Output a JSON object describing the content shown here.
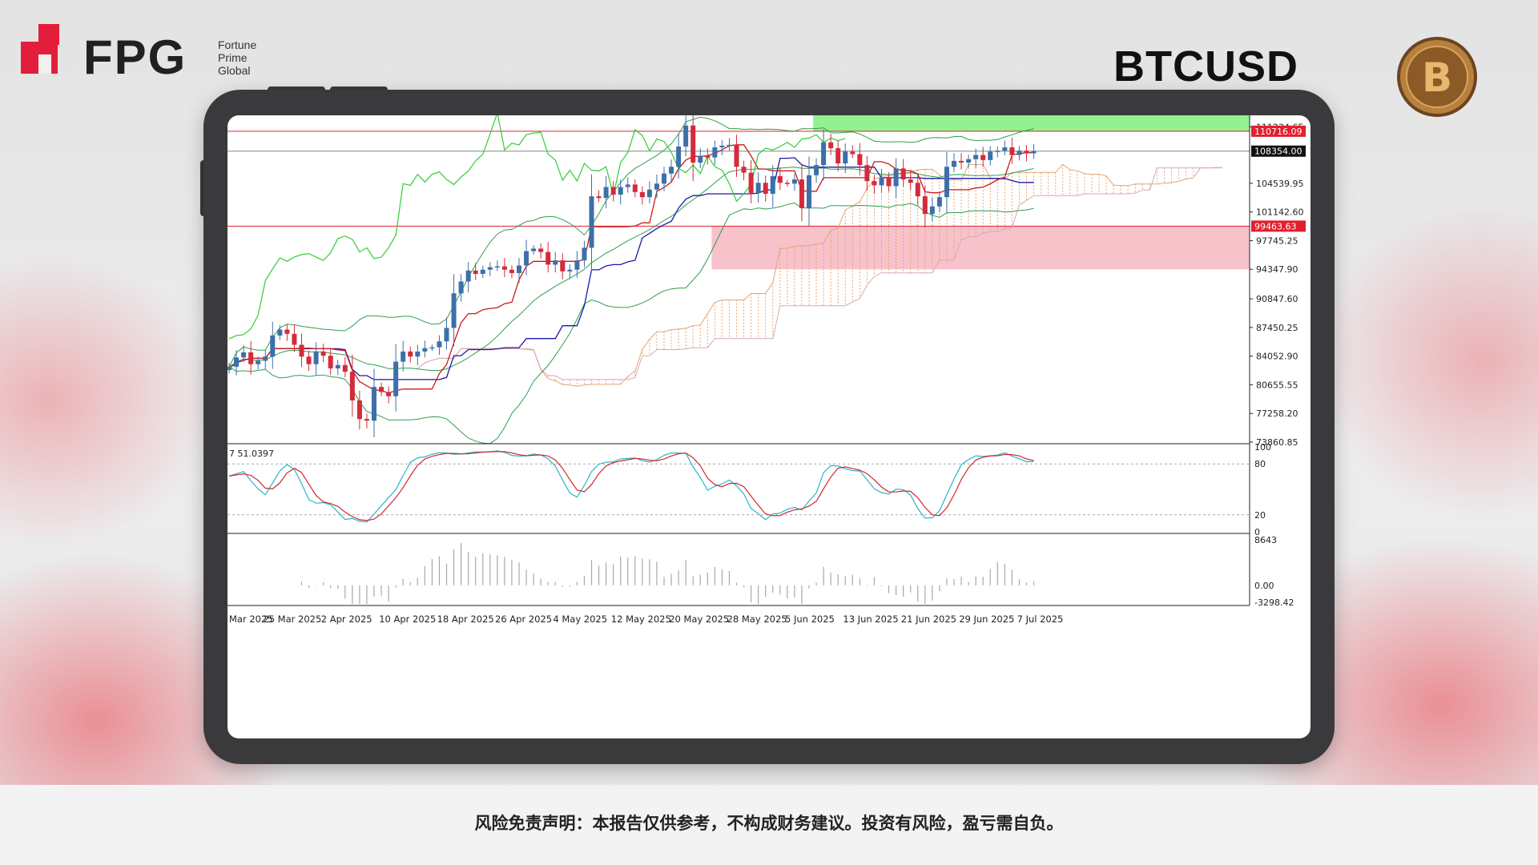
{
  "brand": {
    "name": "FPG",
    "subtitle": "Fortune\nPrime\nGlobal"
  },
  "header": {
    "symbol": "BTCUSD"
  },
  "footer": {
    "disclaimer": "风险免责声明：本报告仅供参考，不构成财务建议。投资有风险，盈亏需自负。"
  },
  "chart_data": {
    "type": "candlestick",
    "symbol": "BTCUSD",
    "price_axis": {
      "ylim": [
        73860.85,
        112600
      ],
      "ticks": [
        "111234.65",
        "104539.95",
        "101142.60",
        "97745.25",
        "94347.90",
        "90847.60",
        "87450.25",
        "84052.90",
        "80655.55",
        "77258.20",
        "73860.85"
      ]
    },
    "price_labels": [
      {
        "text": "110716.09",
        "value": 110716.09,
        "color": "#e0202e"
      },
      {
        "text": "108354.00",
        "value": 108354.0,
        "color": "#111111"
      },
      {
        "text": "99463.63",
        "value": 99463.63,
        "color": "#e0202e"
      }
    ],
    "horizontal_lines": [
      {
        "value": 110716.09,
        "color": "#e0202e"
      },
      {
        "value": 108354.0,
        "color": "#7a8a8c"
      },
      {
        "value": 99463.63,
        "color": "#e0202e"
      }
    ],
    "zones": [
      {
        "name": "resistance",
        "from": 110716.09,
        "to": 112600,
        "color": "#7ef07e",
        "start_index": 81
      },
      {
        "name": "support",
        "from": 94347.9,
        "to": 99463.63,
        "color": "#f7b7c2",
        "start_index": 67
      }
    ],
    "x_labels": [
      "Mar 2025",
      "25 Mar 2025",
      "2 Apr 2025",
      "10 Apr 2025",
      "18 Apr 2025",
      "26 Apr 2025",
      "4 May 2025",
      "12 May 2025",
      "20 May 2025",
      "28 May 2025",
      "5 Jun 2025",
      "13 Jun 2025",
      "21 Jun 2025",
      "29 Jun 2025",
      "7 Jul 2025"
    ],
    "closes": [
      82800,
      83900,
      84500,
      83100,
      83500,
      84000,
      86500,
      87200,
      86700,
      85400,
      84000,
      83100,
      84600,
      84100,
      82600,
      83000,
      82200,
      78800,
      76600,
      76400,
      80400,
      79800,
      79300,
      83400,
      84600,
      84000,
      84600,
      85000,
      85100,
      85800,
      87400,
      91500,
      92900,
      94200,
      93800,
      94300,
      94600,
      94700,
      94300,
      93900,
      94800,
      96500,
      96800,
      96400,
      94900,
      95400,
      94100,
      94300,
      95400,
      96900,
      103000,
      102800,
      104100,
      103200,
      104100,
      104400,
      103500,
      102900,
      103800,
      104500,
      105700,
      106500,
      108900,
      111400,
      107000,
      107800,
      107600,
      108800,
      109000,
      109100,
      106500,
      105800,
      103400,
      104600,
      103300,
      105400,
      104600,
      104500,
      105000,
      101600,
      105500,
      106700,
      109400,
      108700,
      106900,
      108300,
      108000,
      106700,
      104800,
      104300,
      105200,
      104200,
      106300,
      105000,
      104600,
      103000,
      100900,
      101800,
      102900,
      106500,
      107200,
      107000,
      107400,
      107900,
      107300,
      108300,
      108400,
      108800,
      107900,
      108400,
      108100,
      108354
    ],
    "indicators": {
      "ichimoku": {
        "tenkan_color": "#cc1a1a",
        "kijun_color": "#1a1aa6",
        "chikou_color": "#33cc33",
        "cloud_up_color": "#e6a470",
        "cloud_down_color": "#d8a8b8"
      },
      "bollinger": {
        "color": "#2e9e4e"
      },
      "stochastic": {
        "label": "7 51.0397",
        "levels": [
          "100",
          "80",
          "20",
          "0"
        ],
        "k_color": "#29b6c8",
        "d_color": "#d02a2a"
      },
      "momentum_histogram": {
        "labels": [
          "8643",
          "0.00",
          "-3298.42"
        ]
      }
    }
  }
}
